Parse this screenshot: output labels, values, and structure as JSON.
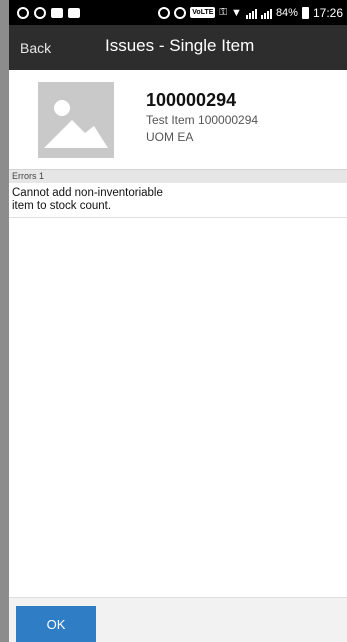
{
  "status_bar": {
    "battery_percent": "84%",
    "time": "17:26",
    "volte_label": "VoLTE"
  },
  "header": {
    "back_label": "Back",
    "title": "Issues - Single Item"
  },
  "item": {
    "number": "100000294",
    "description": "Test Item 100000294",
    "uom": "UOM EA"
  },
  "errors": {
    "header_label": "Errors 1",
    "items": [
      {
        "lines": [
          "Cannot add non-inventoriable",
          "item to stock count."
        ]
      }
    ]
  },
  "footer": {
    "ok_label": "OK"
  },
  "colors": {
    "header_bg": "#2d2d2d",
    "ok_button": "#2f7dc4",
    "status_bar_bg": "#000000"
  },
  "icons": [
    "whatsapp-icon",
    "gmail-icon",
    "message-icon",
    "notification-icon",
    "dnd-icon",
    "alarm-icon",
    "key-icon",
    "wifi-icon",
    "signal-icon",
    "battery-icon",
    "image-placeholder-icon"
  ]
}
